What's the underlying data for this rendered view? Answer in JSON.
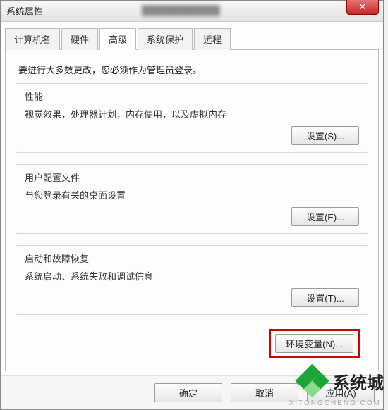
{
  "title": "系统属性",
  "tabs": {
    "computer_name": "计算机名",
    "hardware": "硬件",
    "advanced": "高级",
    "system_protection": "系统保护",
    "remote": "远程"
  },
  "advanced_panel": {
    "intro": "要进行大多数更改，您必须作为管理员登录。",
    "performance": {
      "title": "性能",
      "desc": "视觉效果，处理器计划，内存使用，以及虚拟内存",
      "settings_btn": "设置(S)..."
    },
    "user_profiles": {
      "title": "用户配置文件",
      "desc": "与您登录有关的桌面设置",
      "settings_btn": "设置(E)..."
    },
    "startup_recovery": {
      "title": "启动和故障恢复",
      "desc": "系统启动、系统失败和调试信息",
      "settings_btn": "设置(T)..."
    },
    "env_vars_btn": "环境变量(N)..."
  },
  "bottom": {
    "ok": "确定",
    "cancel": "取消",
    "apply": "应用(A)"
  },
  "watermark": {
    "text": "系统城",
    "sub": "XITONGCHENG.COM"
  }
}
